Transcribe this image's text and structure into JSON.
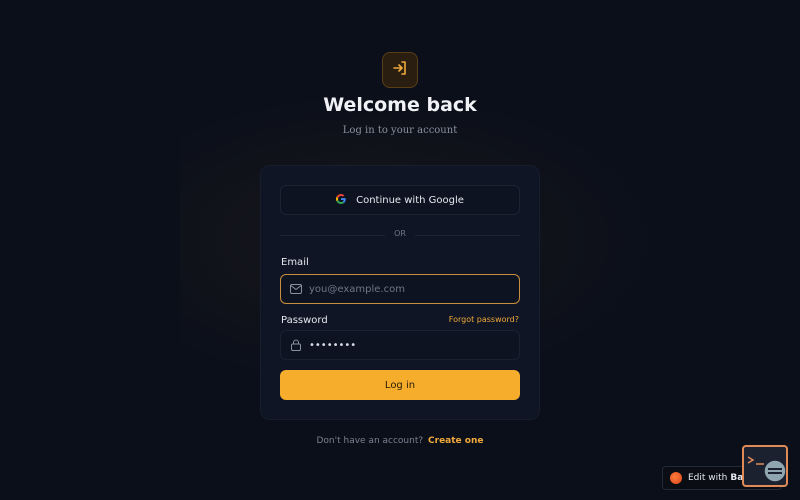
{
  "header": {
    "logo_icon": "login-arrow-icon",
    "title": "Welcome back",
    "subtitle": "Log in to your account"
  },
  "auth": {
    "google_button_label": "Continue with Google",
    "divider_text": "OR",
    "email_label": "Email",
    "email_placeholder": "you@example.com",
    "email_value": "",
    "password_label": "Password",
    "forgot_password_label": "Forgot password?",
    "password_value": "password",
    "login_button_label": "Log in"
  },
  "footer": {
    "signup_prompt": "Don't have an account?",
    "signup_link": "Create one"
  },
  "badge": {
    "label": "Edit with",
    "brand": "Base44"
  },
  "colors": {
    "background": "#0b0f1a",
    "accent": "#f6ad2c",
    "card": "#0f1524",
    "focus_border": "#c98e3c"
  }
}
